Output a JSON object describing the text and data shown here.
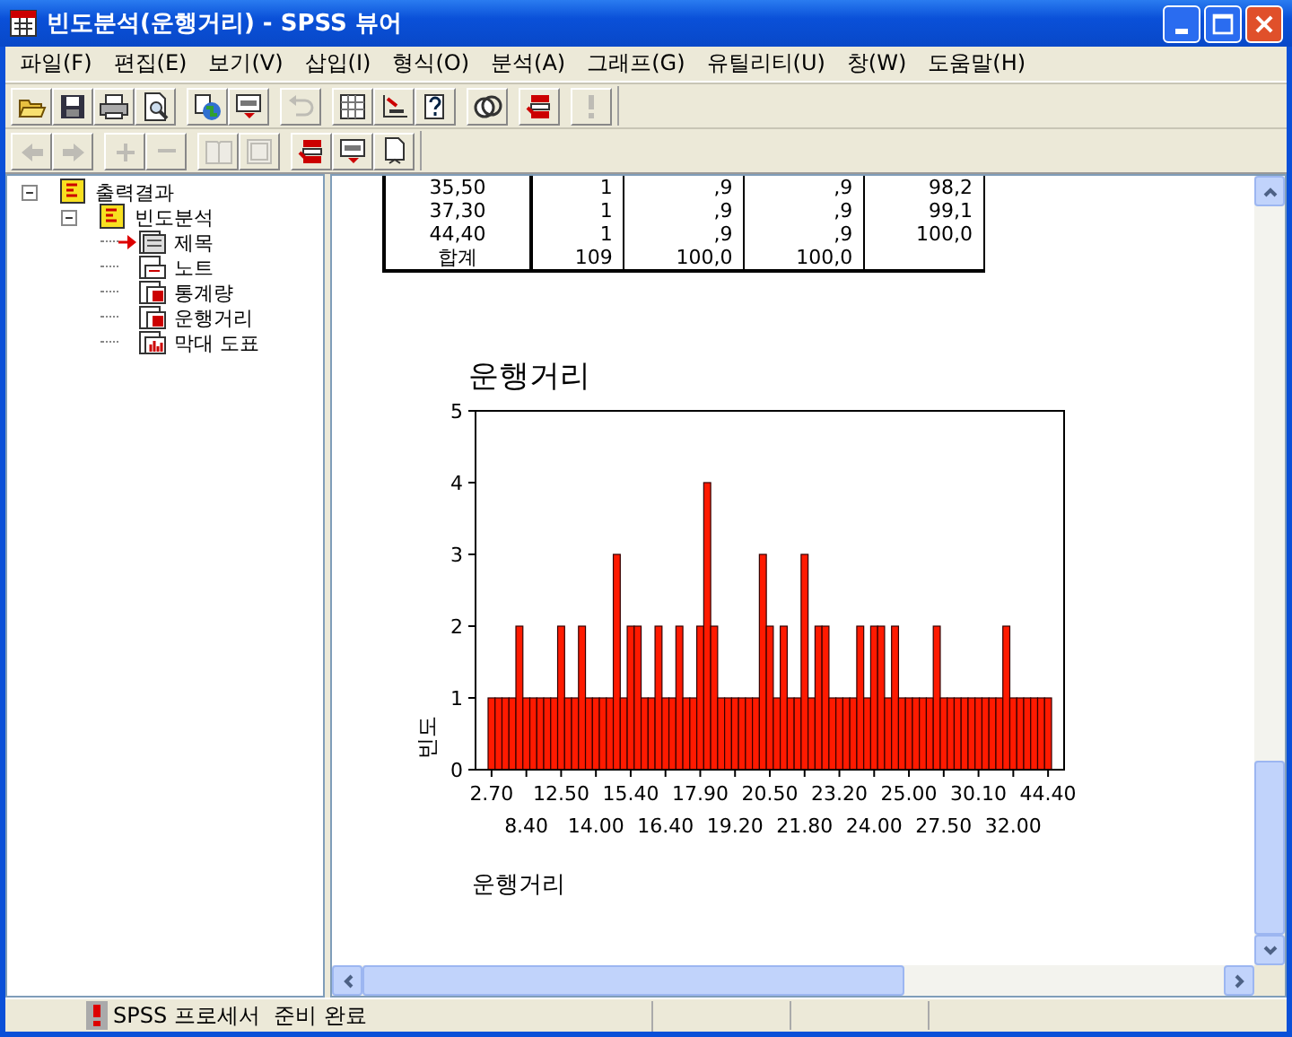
{
  "window": {
    "title": "빈도분석(운행거리) - SPSS 뷰어"
  },
  "menu": [
    "파일(F)",
    "편집(E)",
    "보기(V)",
    "삽입(I)",
    "형식(O)",
    "분석(A)",
    "그래프(G)",
    "유틸리티(U)",
    "창(W)",
    "도움말(H)"
  ],
  "toolbars": [
    {
      "buttons": [
        {
          "kind": "open",
          "disabled": false
        },
        {
          "kind": "save",
          "disabled": false
        },
        {
          "kind": "print",
          "disabled": false
        },
        {
          "kind": "preview",
          "disabled": false
        },
        {
          "kind": "globe",
          "disabled": false,
          "group_start": true
        },
        {
          "kind": "dialog",
          "disabled": false
        },
        {
          "kind": "undo",
          "disabled": true,
          "group_start": true
        },
        {
          "kind": "grid",
          "disabled": false,
          "group_start": true
        },
        {
          "kind": "axis",
          "disabled": false
        },
        {
          "kind": "help",
          "disabled": false
        },
        {
          "kind": "circles",
          "disabled": false,
          "group_start": true
        },
        {
          "kind": "stack",
          "disabled": false,
          "group_start": true
        },
        {
          "kind": "exclaim",
          "disabled": true,
          "group_start": true
        }
      ]
    },
    {
      "buttons": [
        {
          "kind": "left",
          "disabled": true
        },
        {
          "kind": "right",
          "disabled": true
        },
        {
          "kind": "plus",
          "disabled": true,
          "group_start": true
        },
        {
          "kind": "minus",
          "disabled": true
        },
        {
          "kind": "book",
          "disabled": true,
          "group_start": true
        },
        {
          "kind": "frame",
          "disabled": true
        },
        {
          "kind": "stack",
          "disabled": false,
          "group_start": true
        },
        {
          "kind": "dialog",
          "disabled": false
        },
        {
          "kind": "page",
          "disabled": false
        }
      ]
    }
  ],
  "outline": [
    {
      "label": "출력결과",
      "kind": "book",
      "selected": false,
      "expanded": true,
      "children": [
        {
          "label": "빈도분석",
          "kind": "book",
          "selected": false,
          "expanded": true,
          "children": [
            {
              "label": "제목",
              "kind": "title",
              "selected": true
            },
            {
              "label": "노트",
              "kind": "note",
              "selected": false
            },
            {
              "label": "통계량",
              "kind": "table",
              "selected": false
            },
            {
              "label": "운행거리",
              "kind": "table",
              "selected": false
            },
            {
              "label": "막대 도표",
              "kind": "chart",
              "selected": false
            }
          ]
        }
      ]
    }
  ],
  "table": {
    "rows": [
      [
        "35,50",
        "1",
        ",9",
        ",9",
        "98,2"
      ],
      [
        "37,30",
        "1",
        ",9",
        ",9",
        "99,1"
      ],
      [
        "44,40",
        "1",
        ",9",
        ",9",
        "100,0"
      ],
      [
        "합계",
        "109",
        "100,0",
        "100,0"
      ]
    ]
  },
  "chart_data": {
    "type": "bar",
    "title": "운행거리",
    "xlabel": "운행거리",
    "ylabel": "빈도",
    "ylim": [
      0,
      5
    ],
    "yticks": [
      0,
      1,
      2,
      3,
      4,
      5
    ],
    "values": [
      1,
      1,
      1,
      1,
      2,
      1,
      1,
      1,
      1,
      1,
      2,
      1,
      1,
      2,
      1,
      1,
      1,
      1,
      3,
      1,
      2,
      2,
      1,
      1,
      2,
      1,
      1,
      2,
      1,
      1,
      2,
      4,
      2,
      1,
      1,
      1,
      1,
      1,
      1,
      3,
      2,
      1,
      2,
      1,
      1,
      3,
      1,
      2,
      2,
      1,
      1,
      1,
      1,
      2,
      1,
      2,
      2,
      1,
      2,
      1,
      1,
      1,
      1,
      1,
      2,
      1,
      1,
      1,
      1,
      1,
      1,
      1,
      1,
      1,
      2,
      1,
      1,
      1,
      1,
      1,
      1
    ],
    "categories": [
      "2.70",
      null,
      null,
      null,
      null,
      "8.40",
      null,
      null,
      null,
      null,
      "12.50",
      null,
      null,
      null,
      null,
      "14.00",
      null,
      null,
      null,
      null,
      "15.40",
      null,
      null,
      null,
      null,
      "16.40",
      null,
      null,
      null,
      null,
      "17.90",
      null,
      null,
      null,
      null,
      "19.20",
      null,
      null,
      null,
      null,
      "20.50",
      null,
      null,
      null,
      null,
      "21.80",
      null,
      null,
      null,
      null,
      "23.20",
      null,
      null,
      null,
      null,
      "24.00",
      null,
      null,
      null,
      null,
      "25.00",
      null,
      null,
      null,
      null,
      "27.50",
      null,
      null,
      null,
      null,
      "30.10",
      null,
      null,
      null,
      null,
      "32.00",
      null,
      null,
      null,
      null,
      "44.40"
    ]
  },
  "status_bar": {
    "message": "SPSS 프로세서  준비 완료"
  }
}
